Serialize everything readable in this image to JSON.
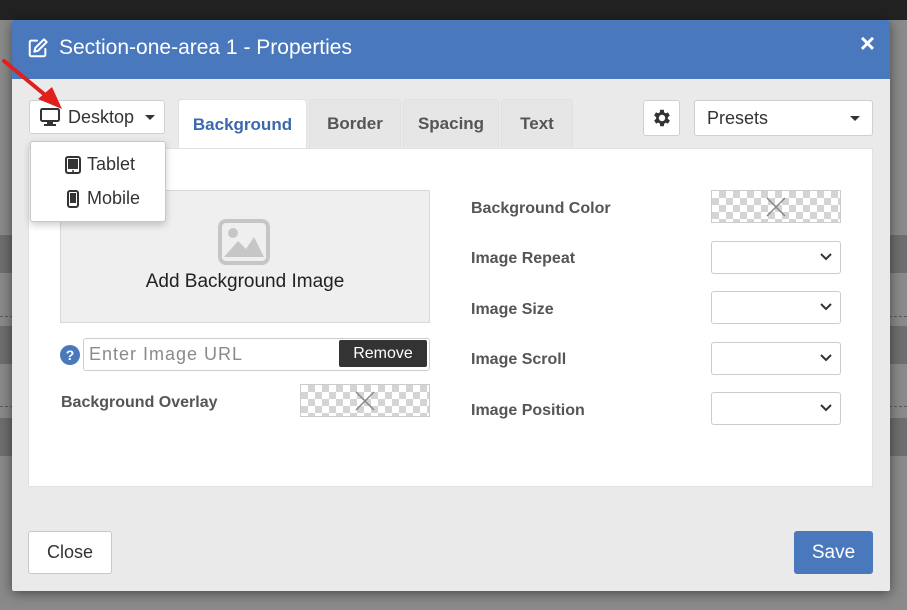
{
  "dialog": {
    "title": "Section-one-area 1 - Properties",
    "close_glyph": "×"
  },
  "device_selector": {
    "selected": "Desktop",
    "options": [
      {
        "label": "Tablet",
        "icon": "tablet-icon"
      },
      {
        "label": "Mobile",
        "icon": "mobile-icon"
      }
    ]
  },
  "tabs": [
    {
      "label": "Background",
      "active": true
    },
    {
      "label": "Border",
      "active": false
    },
    {
      "label": "Spacing",
      "active": false
    },
    {
      "label": "Text",
      "active": false
    }
  ],
  "presets": {
    "selected": "Presets"
  },
  "background_panel": {
    "add_image_label": "Add Background Image",
    "help_glyph": "?",
    "url_placeholder": "Enter Image URL",
    "remove_label": "Remove",
    "overlay_label": "Background Overlay",
    "fields": [
      {
        "label": "Background Color",
        "type": "color"
      },
      {
        "label": "Image Repeat",
        "type": "select",
        "value": ""
      },
      {
        "label": "Image Size",
        "type": "select",
        "value": ""
      },
      {
        "label": "Image Scroll",
        "type": "select",
        "value": ""
      },
      {
        "label": "Image Position",
        "type": "select",
        "value": ""
      }
    ]
  },
  "footer": {
    "close_label": "Close",
    "save_label": "Save"
  },
  "colors": {
    "header_blue": "#4a78bd",
    "active_tab_text": "#3c69ad",
    "annotation_arrow": "#e0201b"
  }
}
